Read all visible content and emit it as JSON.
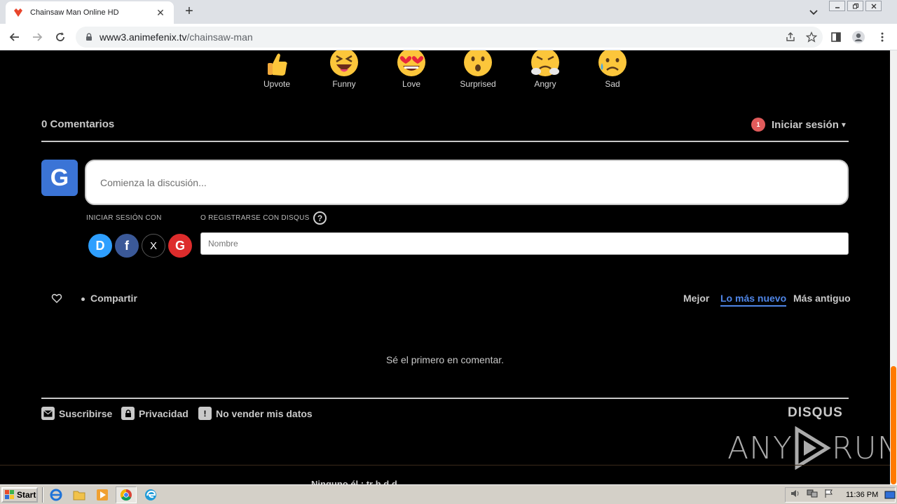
{
  "browser": {
    "tab_title": "Chainsaw Man Online HD",
    "close_glyph": "✕",
    "new_tab_glyph": "+",
    "url_host": "www3.animefenix.tv",
    "url_path": "/chainsaw-man"
  },
  "reactions": [
    {
      "label": "Upvote"
    },
    {
      "label": "Funny"
    },
    {
      "label": "Love"
    },
    {
      "label": "Surprised"
    },
    {
      "label": "Angry"
    },
    {
      "label": "Sad"
    }
  ],
  "disqus": {
    "comment_count": "0 Comentarios",
    "notification_count": "1",
    "login_label": "Iniciar sesión",
    "login_caret": "▾",
    "avatar_letter": "G",
    "composer_placeholder": "Comienza la discusión...",
    "login_with_label": "INICIAR SESIÓN CON",
    "register_label": "O REGISTRARSE CON DISQUS",
    "help_glyph": "?",
    "social": [
      {
        "name": "disqus",
        "glyph": "D",
        "color": "#2e9fff"
      },
      {
        "name": "facebook",
        "glyph": "f",
        "color": "#3b5998"
      },
      {
        "name": "x",
        "glyph": "X",
        "color": "#000000"
      },
      {
        "name": "google",
        "glyph": "G",
        "color": "#dd2c2c"
      }
    ],
    "name_placeholder": "Nombre",
    "share_label": "Compartir",
    "sort_options": [
      {
        "label": "Mejor",
        "active": false
      },
      {
        "label": "Lo más nuevo",
        "active": true
      },
      {
        "label": "Más antiguo",
        "active": false
      }
    ],
    "empty_message": "Sé el primero en comentar.",
    "footer": {
      "subscribe": "Suscribirse",
      "privacy": "Privacidad",
      "do_not_sell": "No vender mis datos",
      "logo": "DISQUS"
    }
  },
  "watermark": {
    "left": "ANY",
    "right": "RUN"
  },
  "page_bottom_text": "Ninguno él       ¡       tr   h d            d",
  "taskbar": {
    "start_label": "Start",
    "clock": "11:36 PM"
  },
  "colors": {
    "accent_blue": "#4f86e8",
    "avatar_blue": "#3b74d6",
    "notification_red": "#e15b5b",
    "scroll_thumb": "#ff7a00"
  }
}
